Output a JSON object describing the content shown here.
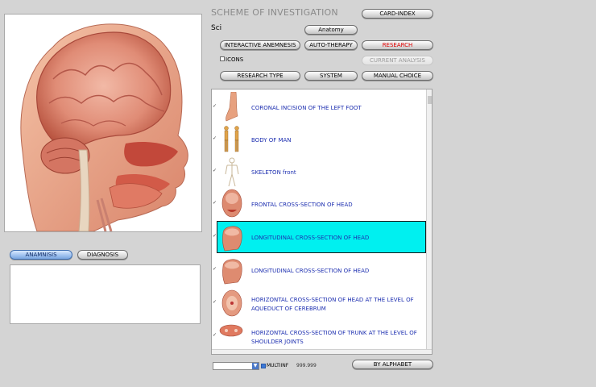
{
  "header": {
    "title": "SCHEME OF INVESTIGATION",
    "card_index": "CARD-INDEX",
    "sci_label": "Sci",
    "anatomy": "Anatomy"
  },
  "toolbar": {
    "interactive_anamnesis": "INTERACTIVE ANEMNESIS",
    "auto_therapy": "AUTO-THERAPY",
    "research": "RESEARCH",
    "icons_label": "ICONS",
    "current_analysis": "CURRENT ANALYSIS",
    "research_type": "RESEARCH TYPE",
    "system": "SYSTEM",
    "manual_choice": "MANUAL CHOICE"
  },
  "left": {
    "anamnesis_tab": "ANAMNISIS",
    "diagnosis_tab": "DIAGNOSIS"
  },
  "list": {
    "items": [
      {
        "label": "CORONAL INCISION OF THE LEFT FOOT"
      },
      {
        "label": "BODY OF MAN"
      },
      {
        "label": "SKELETON front"
      },
      {
        "label": "FRONTAL CROSS-SECTION OF HEAD"
      },
      {
        "label": "LONGITUDINAL CROSS-SECTION OF HEAD",
        "selected": true
      },
      {
        "label": "LONGITUDINAL CROSS-SECTION OF HEAD"
      },
      {
        "label": "HORIZONTAL CROSS-SECTION OF HEAD AT THE LEVEL OF AQUEDUCT OF CEREBRUM"
      },
      {
        "label": "HORIZONTAL CROSS-SECTION OF TRUNK AT THE LEVEL OF SHOULDER JOINTS"
      }
    ]
  },
  "bottom": {
    "multiinf_label": "MULTIINF",
    "value": "999.999",
    "by_alphabet": "BY ALPHABET"
  },
  "colors": {
    "background": "#d4d4d4",
    "selection": "#00f0f0",
    "link": "#1d2fb0",
    "research": "#e00000"
  }
}
